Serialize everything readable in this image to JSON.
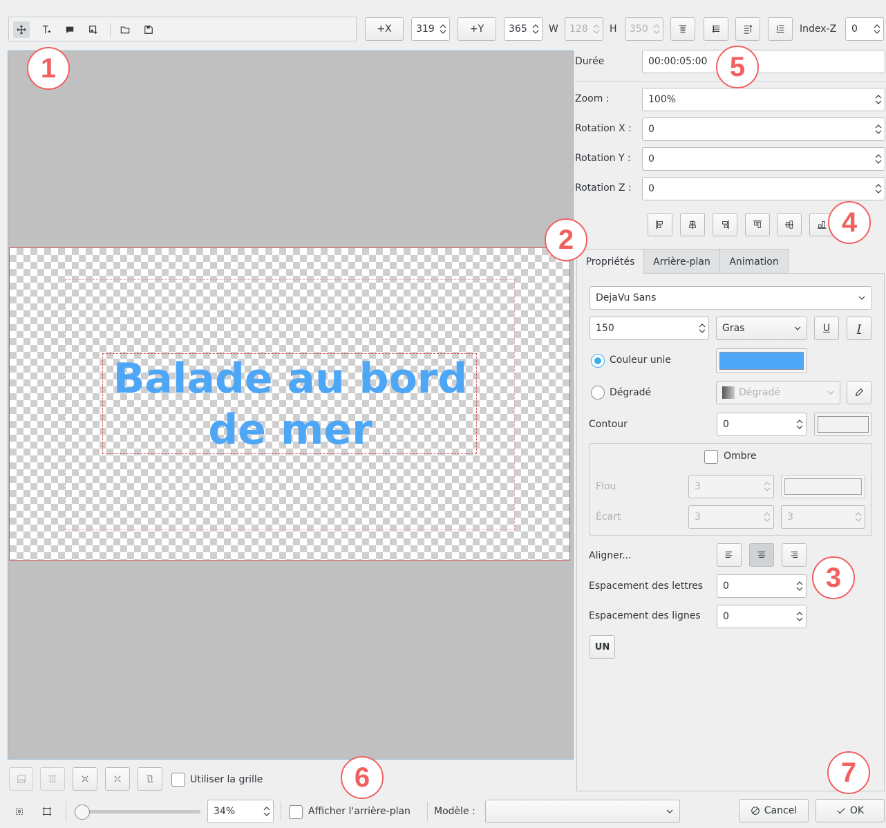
{
  "toolbar": {
    "left_icons": [
      "select-icon",
      "add-text-icon",
      "add-rect-icon",
      "add-image-icon",
      "open-document-icon",
      "save-as-icon"
    ],
    "plus_x_label": "+X",
    "x_value": "319",
    "plus_y_label": "+Y",
    "y_value": "365",
    "w_label": "W",
    "w_value": "128",
    "h_label": "H",
    "h_value": "350",
    "zindex_label": "Index-Z",
    "zindex_value": "0"
  },
  "canvas": {
    "title_line1": "Balade au bord",
    "title_line2": "de mer",
    "text_color": "#4ea6f6"
  },
  "right": {
    "duration_label": "Durée",
    "duration_value": "00:00:05:00",
    "zoom_label": "Zoom :",
    "zoom_value": "100%",
    "rotx_label": "Rotation X :",
    "rotx_value": "0",
    "roty_label": "Rotation Y :",
    "roty_value": "0",
    "rotz_label": "Rotation Z :",
    "rotz_value": "0"
  },
  "tabs": [
    "Propriétés",
    "Arrière-plan",
    "Animation"
  ],
  "props": {
    "font_value": "DejaVu Sans",
    "size_value": "150",
    "weight_value": "Gras",
    "underline_label": "U",
    "italic_label": "I",
    "solid_label": "Couleur unie",
    "solid_color": "#4ea6f6",
    "gradient_label": "Dégradé",
    "gradient_select": "Dégradé",
    "outline_label": "Contour",
    "outline_value": "0",
    "shadow_label": "Ombre",
    "blur_label": "Flou",
    "blur_value": "3",
    "offset_label": "Écart",
    "offset_x": "3",
    "offset_y": "3",
    "align_label": "Aligner...",
    "letter_spacing_label": "Espacement des lettres",
    "letter_spacing_value": "0",
    "line_spacing_label": "Espacement des lignes",
    "line_spacing_value": "0",
    "typewriter_label": "UN"
  },
  "bottom": {
    "grid_label": "Utiliser la grille",
    "zoom_percent": "34%",
    "zoom_fraction": 0.05,
    "show_bg_label": "Afficher l'arrière-plan",
    "template_label": "Modèle :",
    "template_value": "",
    "cancel_label": "Cancel",
    "ok_label": "OK"
  },
  "callouts": [
    "1",
    "2",
    "3",
    "4",
    "5",
    "6",
    "7"
  ],
  "accent_color": "#3daee9",
  "callout_color": "#f25f5f"
}
